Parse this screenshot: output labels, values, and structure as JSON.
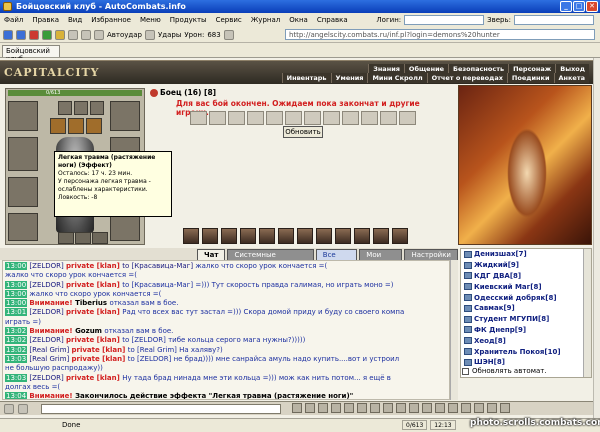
{
  "window": {
    "title": "Бойцовский клуб - AutoCombats.info"
  },
  "menu": {
    "items": [
      "Файл",
      "Правка",
      "Вид",
      "Избранное",
      "Меню",
      "Продукты",
      "Сервис",
      "Журнал",
      "Окна",
      "Справка"
    ],
    "login_label": "Логин:",
    "beast_label": "Зверь:"
  },
  "toolbar": {
    "autoudar": "Автоудар",
    "udary": "Удары",
    "uron_label": "Урон:",
    "uron_value": "683",
    "address": "http://angelscity.combats.ru/inf.pl?login=demons%20hunter"
  },
  "tabbar": {
    "tab_label": "Бойцовский клуб"
  },
  "game": {
    "logo": "CAPITALCITY",
    "nav_top": [
      "Знания",
      "Общение",
      "Безопасность",
      "Персонаж",
      "Выход"
    ],
    "nav_bottom": [
      "Инвентарь",
      "Умения",
      "Мини Скролл",
      "Отчет о переводах",
      "Поединки",
      "Анкета"
    ],
    "hp_text": "0/613",
    "fighter": "Боец (16) [8]",
    "battle_message": "Для вас бой окончен. Ожидаем пока закончат и другие игроки...",
    "refresh_button": "Обновить",
    "counters": [
      "2",
      "0",
      "1",
      "0",
      "0",
      "0"
    ],
    "tooltip": {
      "title": "Легкая травма (растяжение ноги) (Эффект)",
      "remaining": "Осталось: 17 ч. 23 мин.",
      "desc": "У персонажа легкая травма - ослаблены характеристики.",
      "stat": "Ловкость: -8"
    }
  },
  "chat": {
    "tabs": [
      "Чат",
      "Системные сообщения",
      "Все логи",
      "Мои логи",
      "Настройки"
    ],
    "lines": [
      {
        "ts": "13:00",
        "parts": [
          {
            "t": "[ZELDOR] ",
            "c": "navy"
          },
          {
            "t": "private [klan] ",
            "c": "red"
          },
          {
            "t": "to [Красавица-Маг] ",
            "c": "navy"
          },
          {
            "t": "жалко что скоро урок кончается =(",
            "c": ""
          }
        ]
      },
      {
        "ts": "",
        "parts": [
          {
            "t": "жалко что скоро урок кончается =(",
            "c": ""
          }
        ]
      },
      {
        "ts": "13:00",
        "parts": [
          {
            "t": "[ZELDOR] ",
            "c": "navy"
          },
          {
            "t": "private [klan] ",
            "c": "red"
          },
          {
            "t": "to [Красавица-Маг] =))) Тут скорость правда галимая, но играть моно =)",
            "c": ""
          }
        ]
      },
      {
        "ts": "13:00",
        "parts": [
          {
            "t": "жалко что скоро урок кончается =(",
            "c": ""
          }
        ]
      },
      {
        "ts": "13:00",
        "parts": [
          {
            "t": "Внимание! ",
            "c": "red"
          },
          {
            "t": "Tiberius ",
            "c": "bold"
          },
          {
            "t": "отказал вам в бое.",
            "c": ""
          }
        ]
      },
      {
        "ts": "13:01",
        "parts": [
          {
            "t": "[ZELDOR] ",
            "c": "navy"
          },
          {
            "t": "private [klan] ",
            "c": "red"
          },
          {
            "t": "Рад что всех вас тут застал =))) Скора домой приду и буду со своего компа",
            "c": ""
          }
        ]
      },
      {
        "ts": "",
        "parts": [
          {
            "t": "играть =)",
            "c": ""
          }
        ]
      },
      {
        "ts": "13:02",
        "parts": [
          {
            "t": "Внимание! ",
            "c": "red"
          },
          {
            "t": "Gozum ",
            "c": "bold"
          },
          {
            "t": "отказал вам в бое.",
            "c": ""
          }
        ]
      },
      {
        "ts": "13:02",
        "parts": [
          {
            "t": "[ZELDOR] ",
            "c": "navy"
          },
          {
            "t": "private [klan] ",
            "c": "red"
          },
          {
            "t": "to [ZELDOR] тибе кольца серого мага нужны?)))))",
            "c": ""
          }
        ]
      },
      {
        "ts": "13:02",
        "parts": [
          {
            "t": "[Real Grim] ",
            "c": "navy"
          },
          {
            "t": "private [klan] ",
            "c": "red"
          },
          {
            "t": "to [Real Grim] На халяву?)",
            "c": ""
          }
        ]
      },
      {
        "ts": "13:03",
        "parts": [
          {
            "t": "[Real Grim] ",
            "c": "navy"
          },
          {
            "t": "private [klan] ",
            "c": "red"
          },
          {
            "t": "to [ZELDOR] не брад)))) мне санрайса амуль надо купить....вот и устроил",
            "c": ""
          }
        ]
      },
      {
        "ts": "",
        "parts": [
          {
            "t": "не большую распродажу))",
            "c": ""
          }
        ]
      },
      {
        "ts": "13:03",
        "parts": [
          {
            "t": "[ZELDOR] ",
            "c": "navy"
          },
          {
            "t": "private [klan] ",
            "c": "red"
          },
          {
            "t": "Ну тада брад нинада мне эти кольца =))) мож как нить потом... я ещё в",
            "c": ""
          }
        ]
      },
      {
        "ts": "",
        "parts": [
          {
            "t": "долгах весь =(",
            "c": ""
          }
        ]
      },
      {
        "ts": "13:04",
        "parts": [
          {
            "t": "Внимание! ",
            "c": "red"
          },
          {
            "t": "Закончилось действие эффекта \"Легкая травма (растяжение ноги)\"",
            "c": "bold"
          }
        ]
      }
    ]
  },
  "users": {
    "list": [
      "Денизшах[7]",
      "Жидкий[9]",
      "КДГ ДВА[8]",
      "Киевский Маг[8]",
      "Одесский добряк[8]",
      "Савмак[9]",
      "Студент МГУПИ[8]",
      "ФК Днепр[9]",
      "Хеод[8]",
      "Хранитель Покоя[10]",
      "ШЭН[8]"
    ],
    "auto_label": "Обновлять автомат."
  },
  "status": {
    "done": "Done",
    "cells": [
      "0/613",
      "12:13"
    ]
  },
  "watermark": "photo.scrolls.combats.com"
}
